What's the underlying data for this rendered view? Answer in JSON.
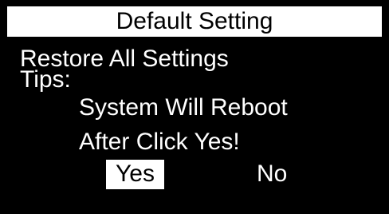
{
  "dialog": {
    "title": "Default Setting",
    "prompt": "Restore All Settings",
    "tips_label": "Tips:",
    "tips_line1": "System Will Reboot",
    "tips_line2": "After Click Yes!",
    "options": [
      {
        "label": "Yes",
        "selected": true
      },
      {
        "label": "No",
        "selected": false
      }
    ]
  },
  "colors": {
    "background": "#000000",
    "foreground": "#ffffff",
    "highlight_bg": "#ffffff",
    "highlight_fg": "#000000"
  }
}
